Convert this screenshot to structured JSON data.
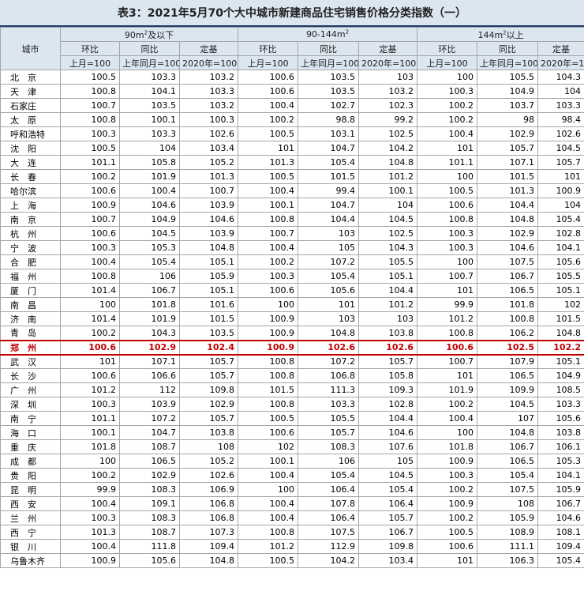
{
  "title": "表3：2021年5月70个大中城市新建商品住宅销售价格分类指数（一）",
  "header": {
    "city": "城市",
    "groups": [
      "90m²及以下",
      "90-144m²",
      "144m²以上"
    ],
    "sub": [
      "环比",
      "同比",
      "定基"
    ],
    "base": [
      "上月=100",
      "上年同月=100",
      "2020年=100"
    ]
  },
  "rows": [
    {
      "city": "北　京",
      "v": [
        "100.5",
        "103.3",
        "103.2",
        "100.6",
        "103.5",
        "103",
        "100",
        "105.5",
        "104.3"
      ]
    },
    {
      "city": "天　津",
      "v": [
        "100.8",
        "104.1",
        "103.3",
        "100.6",
        "103.5",
        "103.2",
        "100.3",
        "104.9",
        "104"
      ]
    },
    {
      "city": "石家庄",
      "v": [
        "100.7",
        "103.5",
        "103.2",
        "100.4",
        "102.7",
        "102.3",
        "100.2",
        "103.7",
        "103.3"
      ]
    },
    {
      "city": "太　原",
      "v": [
        "100.8",
        "100.1",
        "100.3",
        "100.2",
        "98.8",
        "99.2",
        "100.2",
        "98",
        "98.4"
      ]
    },
    {
      "city": "呼和浩特",
      "v": [
        "100.3",
        "103.3",
        "102.6",
        "100.5",
        "103.1",
        "102.5",
        "100.4",
        "102.9",
        "102.6"
      ]
    },
    {
      "city": "沈　阳",
      "v": [
        "100.5",
        "104",
        "103.4",
        "101",
        "104.7",
        "104.2",
        "101",
        "105.7",
        "104.5"
      ]
    },
    {
      "city": "大　连",
      "v": [
        "101.1",
        "105.8",
        "105.2",
        "101.3",
        "105.4",
        "104.8",
        "101.1",
        "107.1",
        "105.7"
      ]
    },
    {
      "city": "长　春",
      "v": [
        "100.2",
        "101.9",
        "101.3",
        "100.5",
        "101.5",
        "101.2",
        "100",
        "101.5",
        "101"
      ]
    },
    {
      "city": "哈尔滨",
      "v": [
        "100.6",
        "100.4",
        "100.7",
        "100.4",
        "99.4",
        "100.1",
        "100.5",
        "101.3",
        "100.9"
      ]
    },
    {
      "city": "上　海",
      "v": [
        "100.9",
        "104.6",
        "103.9",
        "100.1",
        "104.7",
        "104",
        "100.6",
        "104.4",
        "104"
      ]
    },
    {
      "city": "南　京",
      "v": [
        "100.7",
        "104.9",
        "104.6",
        "100.8",
        "104.4",
        "104.5",
        "100.8",
        "104.8",
        "105.4"
      ]
    },
    {
      "city": "杭　州",
      "v": [
        "100.6",
        "104.5",
        "103.9",
        "100.7",
        "103",
        "102.5",
        "100.3",
        "102.9",
        "102.8"
      ]
    },
    {
      "city": "宁　波",
      "v": [
        "100.3",
        "105.3",
        "104.8",
        "100.4",
        "105",
        "104.3",
        "100.3",
        "104.6",
        "104.1"
      ]
    },
    {
      "city": "合　肥",
      "v": [
        "100.4",
        "105.4",
        "105.1",
        "100.2",
        "107.2",
        "105.5",
        "100",
        "107.5",
        "105.6"
      ]
    },
    {
      "city": "福　州",
      "v": [
        "100.8",
        "106",
        "105.9",
        "100.3",
        "105.4",
        "105.1",
        "100.7",
        "106.7",
        "105.5"
      ]
    },
    {
      "city": "厦　门",
      "v": [
        "101.4",
        "106.7",
        "105.1",
        "100.6",
        "105.6",
        "104.4",
        "101",
        "106.5",
        "105.1"
      ]
    },
    {
      "city": "南　昌",
      "v": [
        "100",
        "101.8",
        "101.6",
        "100",
        "101",
        "101.2",
        "99.9",
        "101.8",
        "102"
      ]
    },
    {
      "city": "济　南",
      "v": [
        "101.4",
        "101.9",
        "101.5",
        "100.9",
        "103",
        "103",
        "101.2",
        "100.8",
        "101.5"
      ]
    },
    {
      "city": "青　岛",
      "v": [
        "100.2",
        "104.3",
        "103.5",
        "100.9",
        "104.8",
        "103.8",
        "100.8",
        "106.2",
        "104.8"
      ]
    },
    {
      "city": "郑　州",
      "hl": true,
      "v": [
        "100.6",
        "102.9",
        "102.4",
        "100.9",
        "102.6",
        "102.6",
        "100.6",
        "102.5",
        "102.2"
      ]
    },
    {
      "city": "武　汉",
      "v": [
        "101",
        "107.1",
        "105.7",
        "100.8",
        "107.2",
        "105.7",
        "100.7",
        "107.9",
        "105.1"
      ]
    },
    {
      "city": "长　沙",
      "v": [
        "100.6",
        "106.6",
        "105.7",
        "100.8",
        "106.8",
        "105.8",
        "101",
        "106.5",
        "104.9"
      ]
    },
    {
      "city": "广　州",
      "v": [
        "101.2",
        "112",
        "109.8",
        "101.5",
        "111.3",
        "109.3",
        "101.9",
        "109.9",
        "108.5"
      ]
    },
    {
      "city": "深　圳",
      "v": [
        "100.3",
        "103.9",
        "102.9",
        "100.8",
        "103.3",
        "102.8",
        "100.2",
        "104.5",
        "103.3"
      ]
    },
    {
      "city": "南　宁",
      "v": [
        "101.1",
        "107.2",
        "105.7",
        "100.5",
        "105.5",
        "104.4",
        "100.4",
        "107",
        "105.6"
      ]
    },
    {
      "city": "海　口",
      "v": [
        "100.1",
        "104.7",
        "103.8",
        "100.6",
        "105.7",
        "104.6",
        "100",
        "104.8",
        "103.8"
      ]
    },
    {
      "city": "重　庆",
      "v": [
        "101.8",
        "108.7",
        "108",
        "102",
        "108.3",
        "107.6",
        "101.8",
        "106.7",
        "106.1"
      ]
    },
    {
      "city": "成　都",
      "v": [
        "100",
        "106.5",
        "105.2",
        "100.1",
        "106",
        "105",
        "100.9",
        "106.5",
        "105.3"
      ]
    },
    {
      "city": "贵　阳",
      "v": [
        "100.2",
        "102.9",
        "102.6",
        "100.4",
        "105.4",
        "104.5",
        "100.3",
        "105.4",
        "104.1"
      ]
    },
    {
      "city": "昆　明",
      "v": [
        "99.9",
        "108.3",
        "106.9",
        "100",
        "106.4",
        "105.4",
        "100.2",
        "107.5",
        "105.9"
      ]
    },
    {
      "city": "西　安",
      "v": [
        "100.4",
        "109.1",
        "106.8",
        "100.4",
        "107.8",
        "106.4",
        "100.9",
        "108",
        "106.7"
      ]
    },
    {
      "city": "兰　州",
      "v": [
        "100.3",
        "108.3",
        "106.8",
        "100.4",
        "106.4",
        "105.7",
        "100.2",
        "105.9",
        "104.6"
      ]
    },
    {
      "city": "西　宁",
      "v": [
        "101.3",
        "108.7",
        "107.3",
        "100.8",
        "107.5",
        "106.7",
        "100.5",
        "108.9",
        "108.1"
      ]
    },
    {
      "city": "银　川",
      "v": [
        "100.4",
        "111.8",
        "109.4",
        "101.2",
        "112.9",
        "109.8",
        "100.6",
        "111.1",
        "109.4"
      ]
    },
    {
      "city": "乌鲁木齐",
      "v": [
        "100.9",
        "105.6",
        "104.8",
        "100.5",
        "104.2",
        "103.4",
        "101",
        "106.3",
        "105.4"
      ]
    }
  ]
}
